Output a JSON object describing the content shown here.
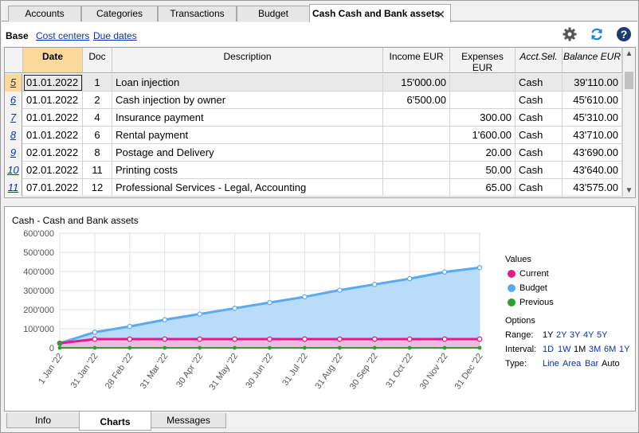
{
  "tabs": [
    "Accounts",
    "Categories",
    "Transactions",
    "Budget",
    "Cash Cash and Bank assets"
  ],
  "subbar": {
    "base": "Base",
    "cost_centers": "Cost centers",
    "due_dates": "Due dates"
  },
  "columns": [
    "Date",
    "Doc",
    "Description",
    "Income EUR",
    "Expenses EUR",
    "Acct.Sel.",
    "Balance EUR"
  ],
  "rows": [
    {
      "n": "5",
      "date": "01.01.2022",
      "doc": "1",
      "desc": "Loan injection",
      "income": "15'000.00",
      "expenses": "",
      "acct": "Cash",
      "balance": "39'110.00"
    },
    {
      "n": "6",
      "date": "01.01.2022",
      "doc": "2",
      "desc": "Cash injection by owner",
      "income": "6'500.00",
      "expenses": "",
      "acct": "Cash",
      "balance": "45'610.00"
    },
    {
      "n": "7",
      "date": "01.01.2022",
      "doc": "4",
      "desc": "Insurance payment",
      "income": "",
      "expenses": "300.00",
      "acct": "Cash",
      "balance": "45'310.00"
    },
    {
      "n": "8",
      "date": "01.01.2022",
      "doc": "6",
      "desc": "Rental payment",
      "income": "",
      "expenses": "1'600.00",
      "acct": "Cash",
      "balance": "43'710.00"
    },
    {
      "n": "9",
      "date": "02.01.2022",
      "doc": "8",
      "desc": "Postage and Delivery",
      "income": "",
      "expenses": "20.00",
      "acct": "Cash",
      "balance": "43'690.00"
    },
    {
      "n": "10",
      "date": "02.01.2022",
      "doc": "11",
      "desc": "Printing costs",
      "income": "",
      "expenses": "50.00",
      "acct": "Cash",
      "balance": "43'640.00"
    },
    {
      "n": "11",
      "date": "07.01.2022",
      "doc": "12",
      "desc": "Professional Services - Legal, Accounting",
      "income": "",
      "expenses": "65.00",
      "acct": "Cash",
      "balance": "43'575.00"
    }
  ],
  "chart_panel": {
    "title": "Cash - Cash and Bank assets",
    "values_title": "Values",
    "options_title": "Options",
    "range_label": "Range:",
    "range_opts": [
      "1Y",
      "2Y",
      "3Y",
      "4Y",
      "5Y"
    ],
    "interval_label": "Interval:",
    "interval_opts": [
      "1D",
      "1W",
      "1M",
      "3M",
      "6M",
      "1Y"
    ],
    "type_label": "Type:",
    "type_opts": [
      "Line",
      "Area",
      "Bar",
      "Auto"
    ]
  },
  "chart_data": {
    "type": "area",
    "x": [
      "1 Jan '22",
      "31 Jan '22",
      "28 Feb '22",
      "31 Mar '22",
      "30 Apr '22",
      "31 May '22",
      "30 Jun '22",
      "31 Jul '22",
      "31 Aug '22",
      "30 Sep '22",
      "31 Oct '22",
      "30 Nov '22",
      "31 Dec '22"
    ],
    "ylim": [
      0,
      600000
    ],
    "yticks": [
      "0",
      "100'000",
      "200'000",
      "300'000",
      "400'000",
      "500'000",
      "600'000"
    ],
    "series": [
      {
        "name": "Current",
        "color": "#e8178a",
        "values": [
          24110,
          45610,
          45610,
          45610,
          45610,
          45610,
          45610,
          45610,
          45610,
          45610,
          45610,
          45610,
          45610
        ]
      },
      {
        "name": "Budget",
        "color": "#5aaaf0",
        "values": [
          24110,
          82000,
          112000,
          147000,
          177000,
          207000,
          237000,
          267000,
          302000,
          332000,
          362000,
          397000,
          420000
        ]
      },
      {
        "name": "Previous",
        "color": "#2ca02c",
        "values": [
          0,
          0,
          0,
          0,
          0,
          0,
          0,
          0,
          0,
          0,
          0,
          0,
          0
        ]
      }
    ],
    "grid": true,
    "legend": "right"
  },
  "bottom_tabs": [
    "Info",
    "Charts",
    "Messages"
  ]
}
